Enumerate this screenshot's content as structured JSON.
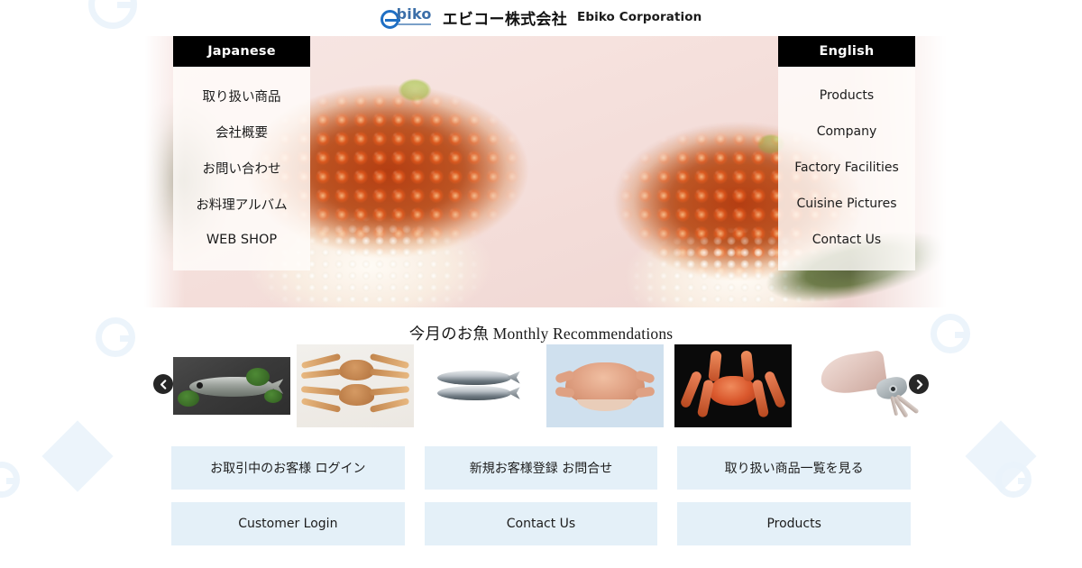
{
  "header": {
    "logo_icon": "ebiko-e-logo-icon",
    "logo_wordmark": "biko",
    "company_name_ja": "エビコー株式会社",
    "company_name_en": "Ebiko Corporation"
  },
  "hero": {
    "image_description": "ikura-salmon-roe-sushi-photo"
  },
  "nav_japanese": {
    "title": "Japanese",
    "items": [
      {
        "label": "取り扱い商品"
      },
      {
        "label": "会社概要"
      },
      {
        "label": "お問い合わせ"
      },
      {
        "label": "お料理アルバム"
      },
      {
        "label": "WEB SHOP"
      }
    ]
  },
  "nav_english": {
    "title": "English",
    "items": [
      {
        "label": "Products"
      },
      {
        "label": "Company"
      },
      {
        "label": "Factory Facilities"
      },
      {
        "label": "Cuisine Pictures"
      },
      {
        "label": "Contact Us"
      }
    ]
  },
  "recommendations": {
    "title": "今月のお魚 Monthly Recommendations",
    "prev_icon": "chevron-left-icon",
    "next_icon": "chevron-right-icon",
    "items": [
      {
        "name": "whole-fish-on-slate"
      },
      {
        "name": "snow-crab"
      },
      {
        "name": "sardines"
      },
      {
        "name": "hairy-crab"
      },
      {
        "name": "king-crab"
      },
      {
        "name": "squid"
      }
    ]
  },
  "cta": {
    "row_ja": [
      {
        "label": "お取引中のお客様 ログイン"
      },
      {
        "label": "新規お客様登録 お問合せ"
      },
      {
        "label": "取り扱い商品一覧を見る"
      }
    ],
    "row_en": [
      {
        "label": "Customer Login"
      },
      {
        "label": "Contact Us"
      },
      {
        "label": "Products"
      }
    ]
  },
  "colors": {
    "nav_header_bg": "#000000",
    "cta_bg": "#e4f0f8",
    "logo_blue": "#1f6fc4",
    "deco_blue": "#e9f2fa"
  }
}
